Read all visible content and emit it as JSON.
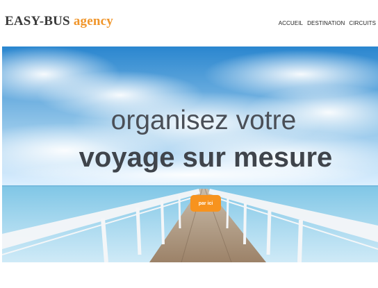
{
  "header": {
    "logo_brand": "EASY-BUS",
    "logo_agency": "agency",
    "nav": [
      "ACCUEIL",
      "DESTINATION",
      "CIRCUITS"
    ]
  },
  "hero": {
    "line1": "organisez votre",
    "line2": "voyage sur mesure",
    "cta_label": "par ici"
  },
  "colors": {
    "accent": "#f7931e",
    "logo_agency": "#f0952a",
    "logo_brand": "#3a3a3a",
    "headline": "#4a4f57"
  },
  "icons": []
}
